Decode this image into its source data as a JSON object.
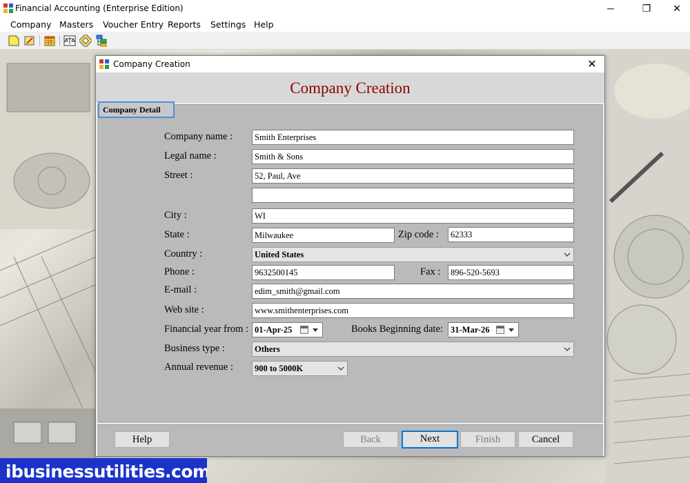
{
  "window": {
    "title": "Financial Accounting (Enterprise Edition)",
    "minimize_glyph": "─",
    "restore_glyph": "❐",
    "close_glyph": "✕"
  },
  "menu": [
    "Company",
    "Masters",
    "Voucher Entry",
    "Reports",
    "Settings",
    "Help"
  ],
  "toolbar_icons": [
    "new-company-icon",
    "open-company-icon",
    "calendar-icon",
    "balance-scale-icon",
    "edit-note-icon",
    "tree-structure-icon"
  ],
  "dialog": {
    "title": "Company Creation",
    "close_glyph": "✕",
    "banner_title": "Company Creation",
    "section_tab": "Company Detail"
  },
  "form": {
    "company_name": {
      "label": "Company name :",
      "value": "Smith Enterprises"
    },
    "legal_name": {
      "label": "Legal name :",
      "value": "Smith & Sons"
    },
    "street": {
      "label": "Street :",
      "value": "52, Paul, Ave",
      "value2": ""
    },
    "city": {
      "label": "City :",
      "value": "WI"
    },
    "state": {
      "label": "State :",
      "value": "Milwaukee"
    },
    "zip": {
      "label": "Zip code :",
      "value": "62333"
    },
    "country": {
      "label": "Country :",
      "value": "United States"
    },
    "phone": {
      "label": "Phone :",
      "value": "9632500145"
    },
    "fax": {
      "label": "Fax :",
      "value": "896-520-5693"
    },
    "email": {
      "label": "E-mail :",
      "value": "edim_smith@gmail.com"
    },
    "website": {
      "label": "Web site :",
      "value": "www.smithenterprises.com"
    },
    "financial_year": {
      "label": "Financial year from :",
      "value": "01-Apr-25"
    },
    "books_beginning": {
      "label": "Books Beginning date:",
      "value": "31-Mar-26"
    },
    "business_type": {
      "label": "Business type :",
      "value": "Others"
    },
    "annual_revenue": {
      "label": "Annual revenue :",
      "value": "900 to 5000K"
    }
  },
  "buttons": {
    "help": "Help",
    "back": "Back",
    "next": "Next",
    "finish": "Finish",
    "cancel": "Cancel"
  },
  "watermark": "ibusinessutilities.com",
  "colors": {
    "banner_title": "#8b0000",
    "focus_border": "#0078d7",
    "watermark_bg": "#1b33c9"
  }
}
